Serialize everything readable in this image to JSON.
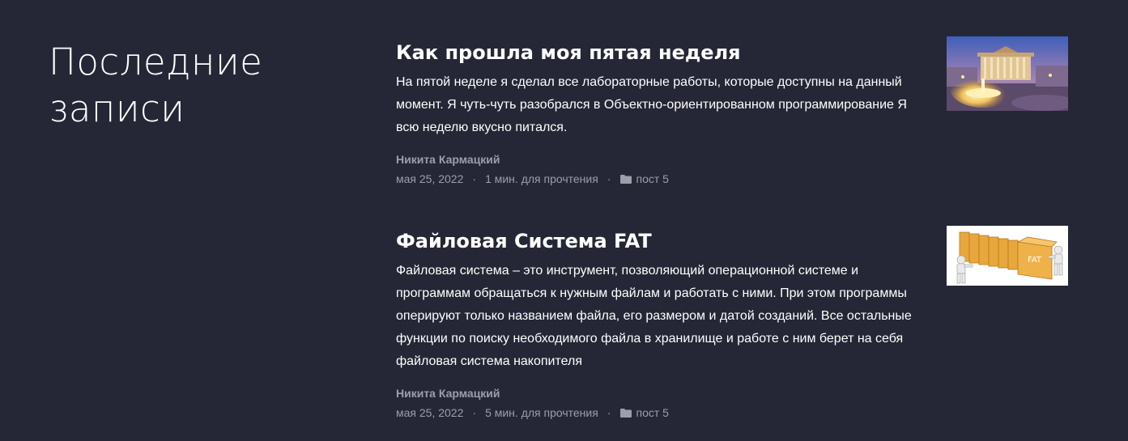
{
  "section": {
    "title": "Последние записи"
  },
  "posts": [
    {
      "title": "Как прошла моя пятая неделя",
      "excerpt": "На пятой неделе я сделал все лабораторные работы, которые доступны на данный момент. Я чуть-чуть разобрался в Объектно-ориентированном программирование Я всю неделю вкусно питался.",
      "author": "Никита Кармацкий",
      "date": "мая 25, 2022",
      "read_time": "1 мин. для прочтения",
      "category": "пост 5",
      "thumbnail_icon": "theatre-fountain-night-photo"
    },
    {
      "title": "Файловая Система FAT",
      "excerpt": "Файловая система – это инструмент, позволяющий операционной системе и программам обращаться к нужным файлам и работать с ними. При этом программы оперируют только названием файла, его размером и датой созданий. Все остальные функции по поиску необходимого файла в хранилище и работе с ним берет на себя файловая система накопителя",
      "author": "Никита Кармацкий",
      "date": "мая 25, 2022",
      "read_time": "5 мин. для прочтения",
      "category": "пост 5",
      "thumbnail_icon": "fat-folders-illustration",
      "thumbnail_label": "FAT"
    }
  ],
  "meta": {
    "separator": "·"
  },
  "colors": {
    "background": "#252736",
    "text": "#ffffff",
    "muted": "#9c9eaa"
  }
}
